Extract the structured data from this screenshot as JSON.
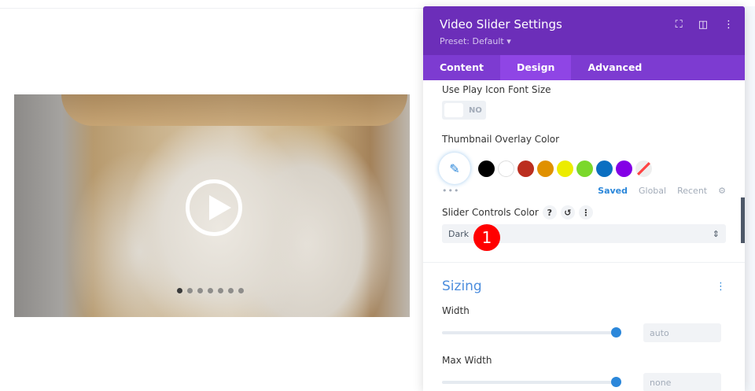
{
  "video": {
    "slide_count": 7,
    "active_slide": 1
  },
  "panel": {
    "title": "Video Slider Settings",
    "preset": "Preset: Default ▾",
    "tabs": [
      "Content",
      "Design",
      "Advanced"
    ],
    "active_tab": "Design",
    "play_icon_size": {
      "label": "Use Play Icon Font Size",
      "value": "NO"
    },
    "overlay_color": {
      "label": "Thumbnail Overlay Color",
      "more": "•••",
      "swatches": [
        "#000000",
        "#ffffff",
        "#bb2e1f",
        "#e09100",
        "#ecec00",
        "#7bd82b",
        "#0b6fc1",
        "#8300e6"
      ],
      "palette_tabs": [
        "Saved",
        "Global",
        "Recent"
      ],
      "active_palette": "Saved"
    },
    "controls_color": {
      "label": "Slider Controls Color",
      "value": "Dark",
      "help": "?",
      "reset": "↺",
      "menu": "⋮"
    },
    "badge": "1",
    "sizing": {
      "title": "Sizing",
      "width_label": "Width",
      "width_value": "auto",
      "max_width_label": "Max Width",
      "max_width_value": "none"
    }
  }
}
